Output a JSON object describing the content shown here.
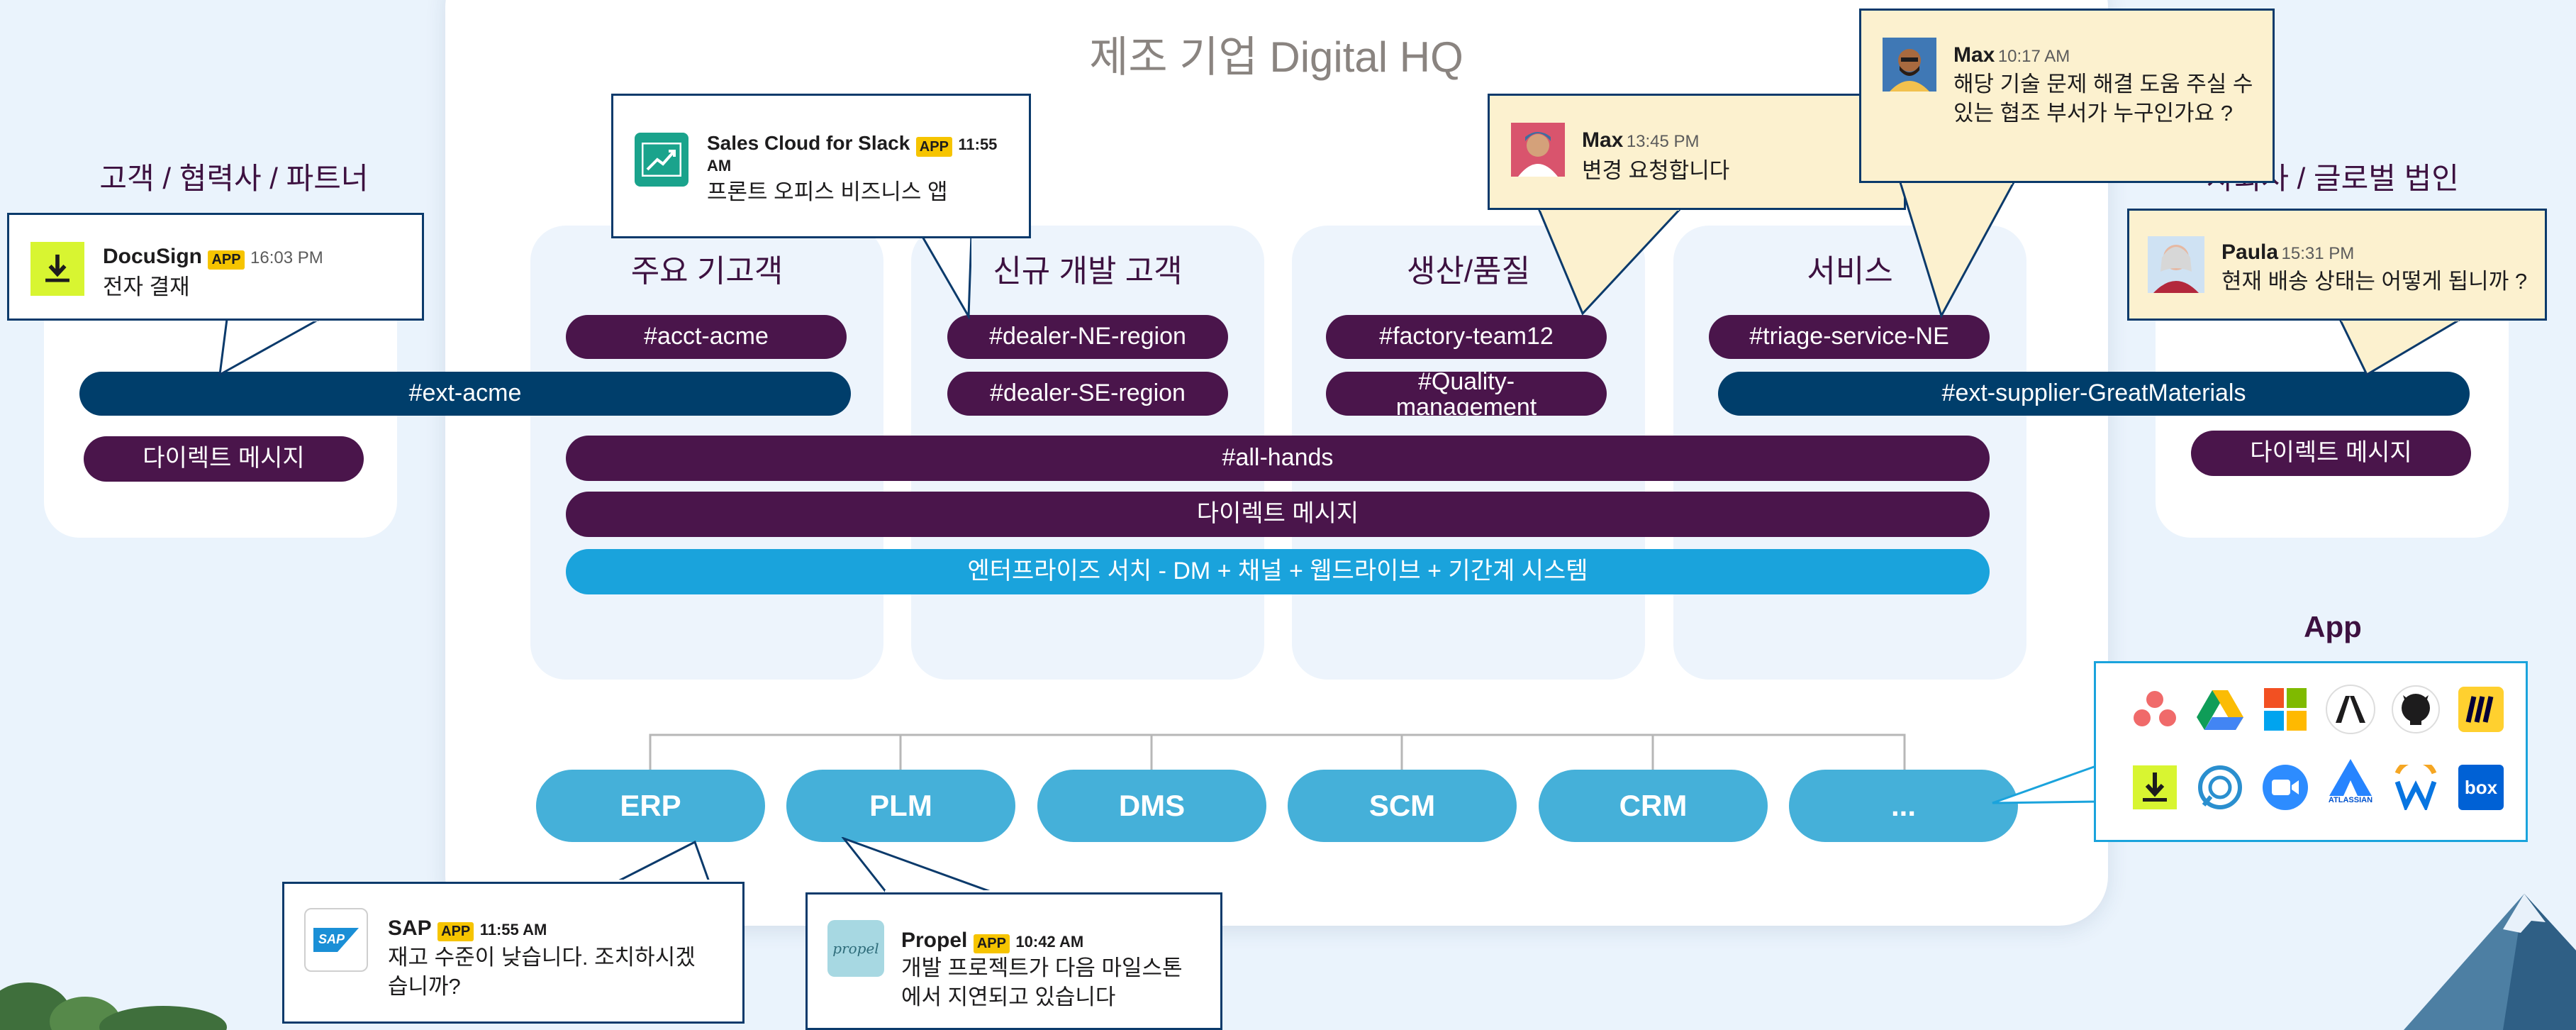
{
  "hub": {
    "title": "제조 기업 Digital HQ"
  },
  "left_group": {
    "title": "고객 / 협력사 / 파트너",
    "channel": "#ext-acme",
    "dm": "다이렉트 메시지"
  },
  "right_group": {
    "title": "자회사 / 글로벌 법인",
    "channel": "#ext-supplier-GreatMaterials",
    "dm": "다이렉트 메시지"
  },
  "columns": [
    {
      "title": "주요 기고객",
      "channels": [
        "#acct-acme"
      ]
    },
    {
      "title": "신규 개발 고객",
      "channels": [
        "#dealer-NE-region",
        "#dealer-SE-region"
      ]
    },
    {
      "title": "생산/품질",
      "channels": [
        "#factory-team12",
        "#Quality-management"
      ]
    },
    {
      "title": "서비스",
      "channels": [
        "#triage-service-NE"
      ]
    }
  ],
  "shared": {
    "all_hands": "#all-hands",
    "dm": "다이렉트 메시지",
    "search": "엔터프라이즈 서치 - DM + 채널 + 웹드라이브 + 기간계 시스템"
  },
  "systems": [
    "ERP",
    "PLM",
    "DMS",
    "SCM",
    "CRM",
    "..."
  ],
  "apps": {
    "title": "App",
    "icons": [
      "asana-icon",
      "google-drive-icon",
      "microsoft-icon",
      "anthropic-icon",
      "github-icon",
      "miro-icon",
      "docusign-icon",
      "quip-icon",
      "zoom-icon",
      "atlassian-icon",
      "workday-icon",
      "box-icon"
    ],
    "atlassian_label": "ATLASSIAN",
    "box_label": "box"
  },
  "messages": {
    "docusign": {
      "name": "DocuSign",
      "badge": "APP",
      "time": "16:03 PM",
      "text": "전자 결재"
    },
    "salescloud": {
      "name": "Sales Cloud for Slack",
      "badge": "APP",
      "time": "11:55",
      "time2": "AM",
      "text": "프론트 오피스 비즈니스 앱"
    },
    "max1": {
      "name": "Max",
      "time": "13:45 PM",
      "text": "변경 요청합니다"
    },
    "max2": {
      "name": "Max",
      "time": "10:17 AM",
      "text": "해당 기술 문제 해결 도움 주실 수 있는 협조 부서가 누구인가요 ?"
    },
    "paula": {
      "name": "Paula",
      "time": "15:31 PM",
      "text": "현재 배송 상태는 어떻게 됩니까 ?"
    },
    "sap": {
      "name": "SAP",
      "badge": "APP",
      "time": "11:55 AM",
      "text": "재고 수준이 낮습니다. 조치하시겠습니까?",
      "logo": "SAP"
    },
    "propel": {
      "name": "Propel",
      "badge": "APP",
      "time": "10:42 AM",
      "text": "개발 프로젝트가 다음 마일스톤에서 지연되고 있습니다",
      "logo": "propel"
    }
  },
  "colors": {
    "purple": "#4a154b",
    "navy": "#003e6b",
    "sky": "#1aa3dc",
    "system": "#45b0d9",
    "bubble_border": "#0b3a6b",
    "bubble_yellow": "#fcf1cf"
  }
}
